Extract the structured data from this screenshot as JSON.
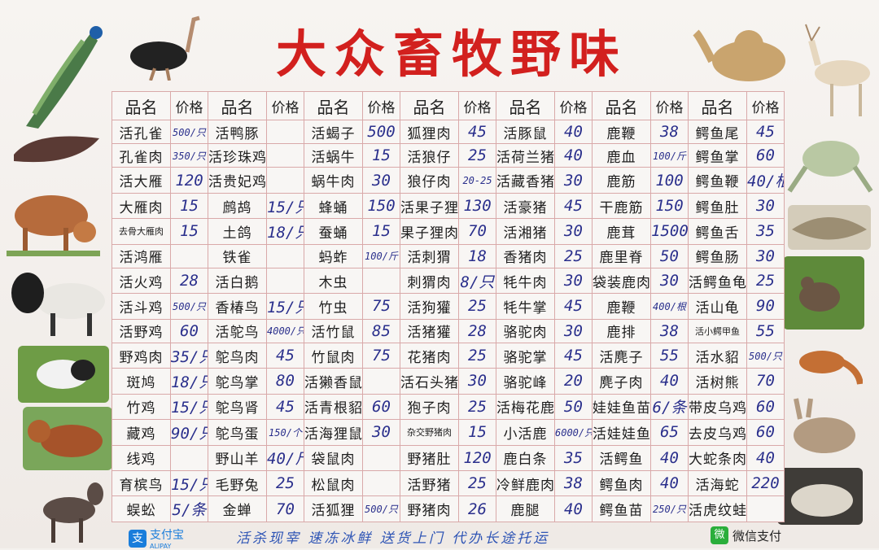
{
  "title": "大众畜牧野味",
  "header": [
    "品名",
    "价格",
    "品名",
    "价格",
    "品名",
    "价格",
    "品名",
    "价格",
    "品名",
    "价格",
    "品名",
    "价格",
    "品名",
    "价格"
  ],
  "rows": [
    [
      "活孔雀",
      "500/只",
      "活鸭豚",
      "",
      "活蝎子",
      "500",
      "狐狸肉",
      "45",
      "活豚鼠",
      "40",
      "鹿鞭",
      "38",
      "鳄鱼尾",
      "45"
    ],
    [
      "孔雀肉",
      "350/只",
      "活珍珠鸡",
      "",
      "活蜗牛",
      "15",
      "活狼仔",
      "25",
      "活荷兰猪",
      "40",
      "鹿血",
      "100/斤",
      "鳄鱼掌",
      "60"
    ],
    [
      "活大雁",
      "120",
      "活贵妃鸡",
      "",
      "蜗牛肉",
      "30",
      "狼仔肉",
      "20-25",
      "活藏香猪",
      "30",
      "鹿筋",
      "100",
      "鳄鱼鞭",
      "40/根"
    ],
    [
      "大雁肉",
      "15",
      "鹧鸪",
      "15/只",
      "蜂蛹",
      "150",
      "活果子狸",
      "130",
      "活豪猪",
      "45",
      "干鹿筋",
      "150",
      "鳄鱼肚",
      "30"
    ],
    [
      "去骨大雁肉",
      "15",
      "土鸽",
      "18/只",
      "蚕蛹",
      "15",
      "果子狸肉",
      "70",
      "活湘猪",
      "30",
      "鹿茸",
      "1500",
      "鳄鱼舌",
      "35"
    ],
    [
      "活鸿雁",
      "",
      "铁雀",
      "",
      "蚂蚱",
      "100/斤",
      "活刺猬",
      "18",
      "香猪肉",
      "25",
      "鹿里脊",
      "50",
      "鳄鱼肠",
      "30"
    ],
    [
      "活火鸡",
      "28",
      "活白鹅",
      "",
      "木虫",
      "",
      "刺猬肉",
      "8/只",
      "牦牛肉",
      "30",
      "袋装鹿肉",
      "30",
      "活鳄鱼龟",
      "25"
    ],
    [
      "活斗鸡",
      "500/只",
      "香椿鸟",
      "15/只",
      "竹虫",
      "75",
      "活狗獾",
      "25",
      "牦牛掌",
      "45",
      "鹿鞭",
      "400/根",
      "活山龟",
      "90"
    ],
    [
      "活野鸡",
      "60",
      "活鸵鸟",
      "4000/只",
      "活竹鼠",
      "85",
      "活猪獾",
      "28",
      "骆驼肉",
      "30",
      "鹿排",
      "38",
      "活小鳄甲鱼",
      "55"
    ],
    [
      "野鸡肉",
      "35/只",
      "鸵鸟肉",
      "45",
      "竹鼠肉",
      "75",
      "花猪肉",
      "25",
      "骆驼掌",
      "45",
      "活麂子",
      "55",
      "活水貂",
      "500/只"
    ],
    [
      "斑鸠",
      "18/只",
      "鸵鸟掌",
      "80",
      "活獭香鼠",
      "",
      "活石头猪",
      "30",
      "骆驼峰",
      "20",
      "麂子肉",
      "40",
      "活树熊",
      "70"
    ],
    [
      "竹鸡",
      "15/只",
      "鸵鸟肾",
      "45",
      "活青根貂",
      "60",
      "狍子肉",
      "25",
      "活梅花鹿",
      "50",
      "娃娃鱼苗",
      "6/条",
      "带皮乌鸡",
      "60"
    ],
    [
      "藏鸡",
      "90/只",
      "鸵鸟蛋",
      "150/个",
      "活海狸鼠",
      "30",
      "杂交野猪肉",
      "15",
      "小活鹿",
      "6000/只",
      "活娃娃鱼",
      "65",
      "去皮乌鸡",
      "60"
    ],
    [
      "线鸡",
      "",
      "野山羊",
      "40/斤",
      "袋鼠肉",
      "",
      "野猪肚",
      "120",
      "鹿白条",
      "35",
      "活鳄鱼",
      "40",
      "大蛇条肉",
      "40"
    ],
    [
      "育槟鸟",
      "15/只",
      "毛野兔",
      "25",
      "松鼠肉",
      "",
      "活野猪",
      "25",
      "冷鲜鹿肉",
      "38",
      "鳄鱼肉",
      "40",
      "活海蛇",
      "220"
    ],
    [
      "蜈蚣",
      "5/条",
      "金蝉",
      "70",
      "活狐狸",
      "500/只",
      "野猪肉",
      "26",
      "鹿腿",
      "40",
      "鳄鱼苗",
      "250/只",
      "活虎纹蛙",
      ""
    ]
  ],
  "footer": {
    "alipay": "支付宝",
    "alipay_en": "ALIPAY",
    "slogan": "活杀现宰  速冻冰鲜  送货上门  代办长途托运",
    "wechat": "微信支付"
  },
  "colors": {
    "title": "#d2201e",
    "handwriting": "#2a2f8c",
    "grid": "#d9a9a9"
  },
  "icons": [
    "peacock-icon",
    "ostrich-icon",
    "sea-cucumber-icon",
    "cattle-icon",
    "goat-icon",
    "pig-icon",
    "dog-icon",
    "donkey-icon",
    "camel-icon",
    "deer-icon",
    "frog-icon",
    "python-skin-icon",
    "bird-photo-icon",
    "fox-icon",
    "rabbit-icon",
    "hedgehog-icon"
  ]
}
